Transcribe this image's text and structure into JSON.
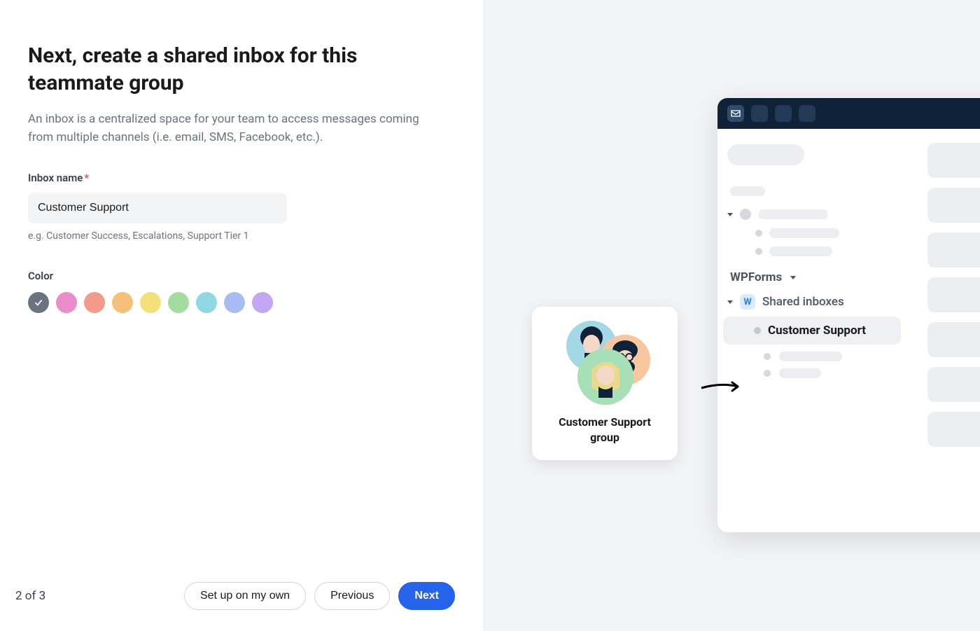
{
  "heading": "Next, create a shared inbox for this teammate group",
  "subtitle": "An inbox is a centralized space for your team to access messages coming from multiple channels (i.e. email, SMS, Facebook, etc.).",
  "form": {
    "inbox_name_label": "Inbox name",
    "inbox_name_value": "Customer Support",
    "inbox_name_hint": "e.g. Customer Success, Escalations, Support Tier 1",
    "color_label": "Color",
    "colors": [
      "#6b7280",
      "#ec8ccb",
      "#f29b8c",
      "#f6c07a",
      "#f4e07a",
      "#a4dca0",
      "#8fd7e2",
      "#a7bdf2",
      "#c3a7f2"
    ],
    "selected_color_index": 0
  },
  "footer": {
    "step_text": "2 of 3",
    "setup_own_label": "Set up on my own",
    "previous_label": "Previous",
    "next_label": "Next"
  },
  "preview": {
    "group_card_label": "Customer Support group",
    "workspace_name": "WPForms",
    "workspace_badge_letter": "W",
    "shared_inboxes_label": "Shared inboxes",
    "highlighted_inbox": "Customer Support"
  }
}
